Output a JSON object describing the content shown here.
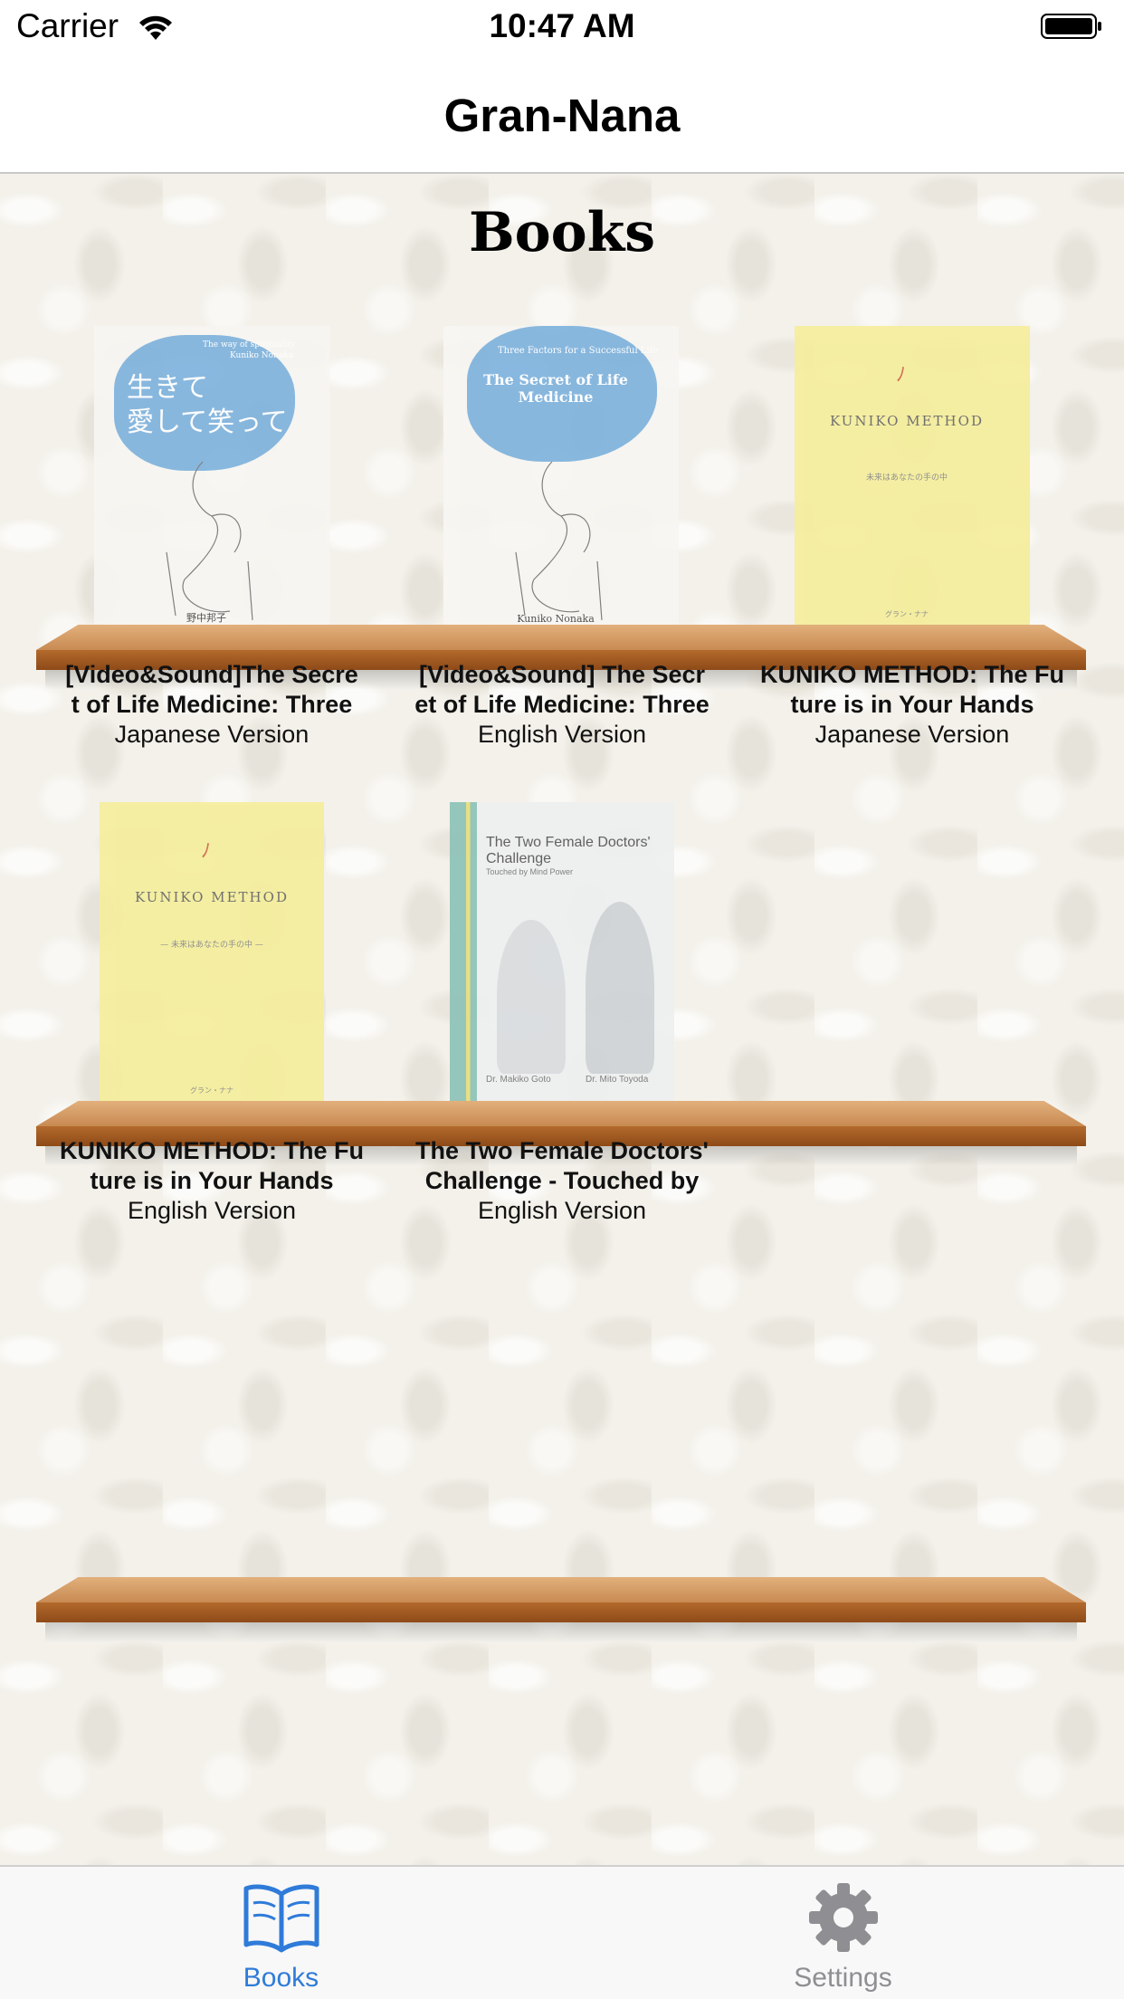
{
  "status_bar": {
    "carrier": "Carrier",
    "time": "10:47 AM"
  },
  "nav": {
    "title": "Gran-Nana"
  },
  "section": {
    "title": "Books"
  },
  "books": [
    {
      "title": "[Video&Sound]The Secre t of Life Medicine: Three",
      "title_line1": "[Video&Sound]The Secre",
      "title_line2": "t of Life Medicine: Three",
      "version": "Japanese Version",
      "cover": {
        "heading": "The way of spirituality",
        "author_en": "Kuniko Nonaka",
        "jp_title_1": "生きて",
        "jp_title_2": "愛して笑って",
        "author_jp": "野中邦子"
      }
    },
    {
      "title": "[Video&Sound] The Secr et of Life Medicine: Three",
      "title_line1": "[Video&Sound] The Secr",
      "title_line2": "et of Life Medicine: Three",
      "version": "English Version",
      "cover": {
        "heading": "Three Factors for a Successful Life",
        "title": "The Secret of Life Medicine",
        "author": "Kuniko Nonaka"
      }
    },
    {
      "title": "KUNIKO METHOD: The Fu ture is in Your Hands",
      "title_line1": "KUNIKO METHOD: The Fu",
      "title_line2": "ture is in Your Hands",
      "version": "Japanese Version",
      "cover": {
        "brand": "KUNIKO METHOD",
        "subtitle": "未来はあなたの手の中",
        "publisher": "グラン・ナナ"
      }
    },
    {
      "title": "KUNIKO METHOD: The Fu ture is in Your Hands",
      "title_line1": "KUNIKO METHOD: The Fu",
      "title_line2": "ture is in Your Hands",
      "version": "English Version",
      "cover": {
        "brand": "KUNIKO METHOD",
        "subtitle": "— 未来はあなたの手の中 —",
        "publisher": "グラン・ナナ"
      }
    },
    {
      "title": "The Two Female Doctors' Challenge - Touched by",
      "title_line1": "The Two Female Doctors'",
      "title_line2": "Challenge - Touched by",
      "version": "English Version",
      "cover": {
        "title": "The Two Female Doctors' Challenge",
        "subtitle": "Touched by Mind Power",
        "doctor_1": "Dr. Makiko Goto",
        "doctor_2": "Dr. Mito Toyoda"
      }
    }
  ],
  "tabs": [
    {
      "label": "Books",
      "icon": "open-book-icon",
      "active": true,
      "color": "#2f7bd9"
    },
    {
      "label": "Settings",
      "icon": "gear-icon",
      "active": false,
      "color": "#8e8e93"
    }
  ]
}
